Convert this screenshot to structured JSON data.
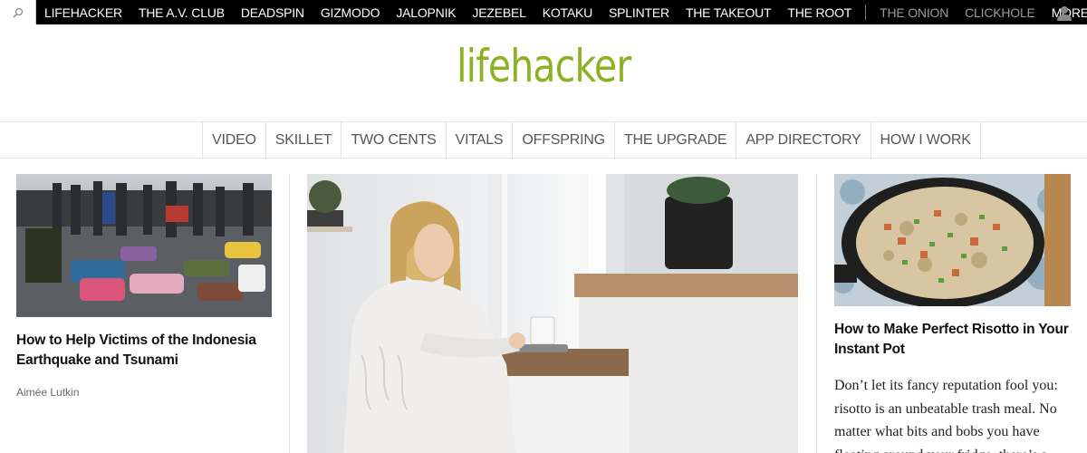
{
  "topbar": {
    "search_icon": "search-icon",
    "sites": [
      "LIFEHACKER",
      "THE A.V. CLUB",
      "DEADSPIN",
      "GIZMODO",
      "JALOPNIK",
      "JEZEBEL",
      "KOTAKU",
      "SPLINTER",
      "THE TAKEOUT",
      "THE ROOT"
    ],
    "sister_sites": [
      "THE ONION",
      "CLICKHOLE"
    ],
    "more_label": "MORE",
    "user_icon": "user-icon"
  },
  "logo": {
    "text": "lifehacker",
    "color": "#8ab224"
  },
  "section_nav": [
    "VIDEO",
    "SKILLET",
    "TWO CENTS",
    "VITALS",
    "OFFSPRING",
    "THE UPGRADE",
    "APP DIRECTORY",
    "HOW I WORK"
  ],
  "articles": {
    "left": {
      "headline": "How to Help Victims of the Indonesia Earthquake and Tsunami",
      "author": "Aimée Lutkin"
    },
    "right": {
      "headline": "How to Make Perfect Risotto in Your Instant Pot",
      "excerpt": "Don’t let its fancy reputation fool you: risotto is an unbeatable trash meal. No matter what bits and bobs you have floating around your fridge, there’s a"
    }
  }
}
